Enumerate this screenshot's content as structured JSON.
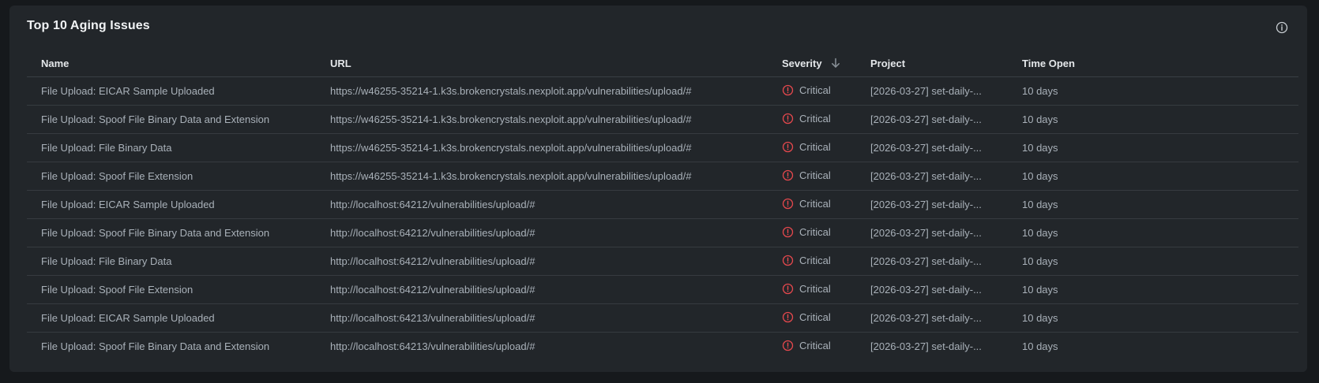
{
  "widget": {
    "title": "Top 10 Aging Issues",
    "info_icon": "info-circle-icon"
  },
  "table": {
    "columns": [
      "Name",
      "URL",
      "Severity",
      "Project",
      "Time Open"
    ],
    "sort": {
      "column": "Severity",
      "direction": "descending",
      "icon": "arrow-down-icon"
    },
    "severity_icon": "alert-circle-icon",
    "severity_color": "#e5484d",
    "rows": [
      {
        "name": "File Upload: EICAR Sample Uploaded",
        "url": "https://w46255-35214-1.k3s.brokencrystals.nexploit.app/vulnerabilities/upload/#",
        "severity": "Critical",
        "project": "[2026-03-27] set-daily-...",
        "time_open": "10 days"
      },
      {
        "name": "File Upload: Spoof File Binary Data and Extension",
        "url": "https://w46255-35214-1.k3s.brokencrystals.nexploit.app/vulnerabilities/upload/#",
        "severity": "Critical",
        "project": "[2026-03-27] set-daily-...",
        "time_open": "10 days"
      },
      {
        "name": "File Upload: File Binary Data",
        "url": "https://w46255-35214-1.k3s.brokencrystals.nexploit.app/vulnerabilities/upload/#",
        "severity": "Critical",
        "project": "[2026-03-27] set-daily-...",
        "time_open": "10 days"
      },
      {
        "name": "File Upload: Spoof File Extension",
        "url": "https://w46255-35214-1.k3s.brokencrystals.nexploit.app/vulnerabilities/upload/#",
        "severity": "Critical",
        "project": "[2026-03-27] set-daily-...",
        "time_open": "10 days"
      },
      {
        "name": "File Upload: EICAR Sample Uploaded",
        "url": "http://localhost:64212/vulnerabilities/upload/#",
        "severity": "Critical",
        "project": "[2026-03-27] set-daily-...",
        "time_open": "10 days"
      },
      {
        "name": "File Upload: Spoof File Binary Data and Extension",
        "url": "http://localhost:64212/vulnerabilities/upload/#",
        "severity": "Critical",
        "project": "[2026-03-27] set-daily-...",
        "time_open": "10 days"
      },
      {
        "name": "File Upload: File Binary Data",
        "url": "http://localhost:64212/vulnerabilities/upload/#",
        "severity": "Critical",
        "project": "[2026-03-27] set-daily-...",
        "time_open": "10 days"
      },
      {
        "name": "File Upload: Spoof File Extension",
        "url": "http://localhost:64212/vulnerabilities/upload/#",
        "severity": "Critical",
        "project": "[2026-03-27] set-daily-...",
        "time_open": "10 days"
      },
      {
        "name": "File Upload: EICAR Sample Uploaded",
        "url": "http://localhost:64213/vulnerabilities/upload/#",
        "severity": "Critical",
        "project": "[2026-03-27] set-daily-...",
        "time_open": "10 days"
      },
      {
        "name": "File Upload: Spoof File Binary Data and Extension",
        "url": "http://localhost:64213/vulnerabilities/upload/#",
        "severity": "Critical",
        "project": "[2026-03-27] set-daily-...",
        "time_open": "10 days"
      }
    ]
  }
}
